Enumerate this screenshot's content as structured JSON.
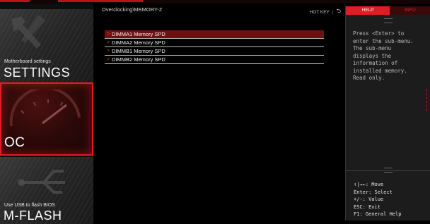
{
  "accent_color": "#e01d24",
  "left_panel": {
    "tiles": [
      {
        "small": "Motherboard settings",
        "big": "SETTINGS",
        "icon": "wrench-hammer-icon"
      },
      {
        "small": "",
        "big": "OC",
        "icon": "speedometer-icon"
      },
      {
        "small": "Use USB to flash BIOS",
        "big": "M-FLASH",
        "icon": "usb-icon"
      }
    ]
  },
  "main": {
    "breadcrumb": "Overclocking\\MEMORY-Z",
    "hotkey_label": "HOT KEY",
    "hotkey_sep": "|",
    "back_icon": "back-arrow-icon",
    "items": [
      {
        "label": "DIMMA1 Memory SPD"
      },
      {
        "label": "DIMMA2 Memory SPD"
      },
      {
        "label": "DIMMB1 Memory SPD"
      },
      {
        "label": "DIMMB2 Memory SPD"
      }
    ],
    "selected_index": 0
  },
  "right_panel": {
    "tabs": {
      "help": "HELP",
      "info": "INFO"
    },
    "help_lines": [
      "Press <Enter> to",
      "enter the sub-menu.",
      "The sub-menu",
      "displays the",
      "information of",
      "installed memory.",
      "Read only."
    ],
    "key_lines": [
      "↑|→←: Move",
      "Enter: Select",
      "+/-: Value",
      "ESC: Exit",
      "F1: General Help"
    ]
  }
}
